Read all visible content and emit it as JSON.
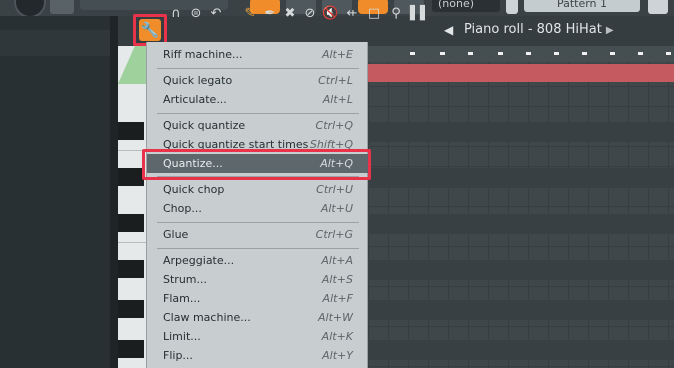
{
  "topbar": {
    "pattern_select": "(none)",
    "pattern_name": "Pattern 1"
  },
  "toolbar": {
    "title": "Piano roll - 808 HiHat",
    "icons": [
      "wrench-icon",
      "magnet-icon",
      "stamp-icon",
      "pencil-icon",
      "brush-icon",
      "delete-icon",
      "mute-icon",
      "slice-icon",
      "select-icon",
      "zoom-icon",
      "playback-icon"
    ]
  },
  "menu": {
    "items": [
      {
        "label": "Riff machine...",
        "shortcut": "Alt+E"
      },
      {
        "label": "Quick legato",
        "shortcut": "Ctrl+L"
      },
      {
        "label": "Articulate...",
        "shortcut": "Alt+L"
      },
      {
        "label": "Quick quantize",
        "shortcut": "Ctrl+Q"
      },
      {
        "label": "Quick quantize start times",
        "shortcut": "Shift+Q"
      },
      {
        "label": "Quantize...",
        "shortcut": "Alt+Q"
      },
      {
        "label": "Quick chop",
        "shortcut": "Ctrl+U"
      },
      {
        "label": "Chop...",
        "shortcut": "Alt+U"
      },
      {
        "label": "Glue",
        "shortcut": "Ctrl+G"
      },
      {
        "label": "Arpeggiate...",
        "shortcut": "Alt+A"
      },
      {
        "label": "Strum...",
        "shortcut": "Alt+S"
      },
      {
        "label": "Flam...",
        "shortcut": "Alt+F"
      },
      {
        "label": "Claw machine...",
        "shortcut": "Alt+W"
      },
      {
        "label": "Limit...",
        "shortcut": "Alt+K"
      },
      {
        "label": "Flip...",
        "shortcut": "Alt+Y"
      }
    ]
  },
  "colors": {
    "accent_orange": "#f08c2a",
    "highlight_red": "#e8334a",
    "note_bar": "#c55b60"
  }
}
